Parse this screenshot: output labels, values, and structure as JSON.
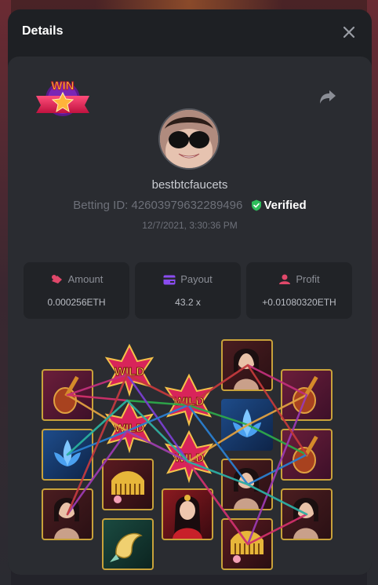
{
  "dialog": {
    "title": "Details"
  },
  "bet": {
    "username": "bestbtcfaucets",
    "betting_id_label": "Betting ID:",
    "betting_id": "42603979632289496",
    "verified_label": "Verified",
    "timestamp": "12/7/2021, 3:30:36 PM"
  },
  "stats": {
    "amount": {
      "label": "Amount",
      "value": "0.000256ETH"
    },
    "payout": {
      "label": "Payout",
      "value": "43.2 x"
    },
    "profit": {
      "label": "Profit",
      "value": "+0.01080320ETH"
    }
  },
  "badge": {
    "text": "WIN"
  },
  "reels": {
    "wild_text": "WILD",
    "symbols": [
      [
        "lute",
        "lotus",
        "lady"
      ],
      [
        "wild",
        "wild",
        "comb",
        "koi"
      ],
      [
        "wild",
        "wild",
        "queen"
      ],
      [
        "lady",
        "lotus",
        "lady",
        "comb"
      ],
      [
        "lute",
        "lute",
        "lady"
      ]
    ]
  },
  "colors": {
    "accent": "#c8a23a",
    "verified_green": "#2ebd5b",
    "amount_icon": "#e0486a",
    "payout_icon": "#8a4cf0",
    "profit_icon": "#e0486a"
  },
  "icons": [
    "close-icon",
    "share-icon",
    "win-badge-icon",
    "shield-check-icon",
    "amount-icon",
    "wallet-icon",
    "profit-icon"
  ]
}
